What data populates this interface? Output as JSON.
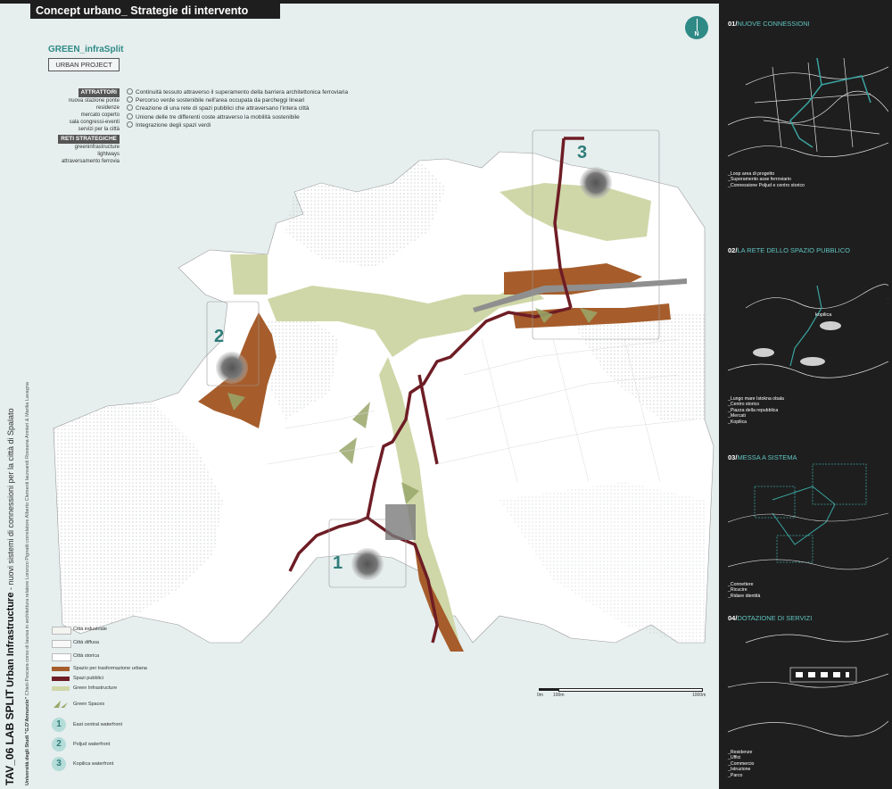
{
  "header": {
    "title": "Concept urbano_ Strategie di intervento"
  },
  "brand": {
    "name": "GREEN_infraSplit",
    "project": "URBAN PROJECT"
  },
  "attrattori": {
    "label": "ATTRATTORI",
    "items": [
      "nuova stazione ponte",
      "residenze",
      "mercato coperto",
      "sala congressi-eventi",
      "servizi per la città"
    ]
  },
  "reti": {
    "label": "RETI STRATEGICHE",
    "items": [
      "greeninfrastructure",
      "lightways",
      "attraversamento ferrovia"
    ]
  },
  "goals": [
    "Continuità tessuto attraverso il superamento della barriera architettonica ferroviaria",
    "Percorso verde sostenibile nell'area occupata da parcheggi lineari",
    "Creazione di una rete di spazi pubblici che attraversano l'intera città",
    "Unione delle tre differenti coste attraverso la mobilità sostenibile",
    "Integrazione degli spazi verdi"
  ],
  "vertical": {
    "tav": "TAV_06 LAB SPLIT",
    "title": "Urban Infrastructure",
    "subtitle": "- nuovi sistemi di connessioni per la città di Spalato",
    "university": "Università degli Studi \"G.D'Annunzio\"",
    "credits": "Chieti-Pescara  corso di laurea in architettura  relatore Lorenzo Pignatti  correlatore Alberto Clementi  laureandi Rossana Armieri & Marilia Lavagna"
  },
  "legend": {
    "items": [
      {
        "label": "Città industriale",
        "color": "#f3f3f0"
      },
      {
        "label": "Città diffusa",
        "color": "#f8f8f8"
      },
      {
        "label": "Città storica",
        "color": "#ffffff"
      },
      {
        "label": "Spazio per trasformazione urbana",
        "color": "#a65d2b"
      },
      {
        "label": "Spazi pubblici",
        "color": "#6e1d25"
      },
      {
        "label": "Green Infrastructure",
        "color": "#cfd7a8"
      },
      {
        "label": "Green Spaces",
        "color": "#9aa86a"
      }
    ],
    "areas": [
      {
        "num": "1",
        "label": "East central waterfront"
      },
      {
        "num": "2",
        "label": "Poljud waterfront"
      },
      {
        "num": "3",
        "label": "Kopilica waterfront"
      }
    ]
  },
  "map_numbers": [
    "1",
    "2",
    "3"
  ],
  "scale": {
    "zero": "0m",
    "mid": "100m",
    "end": "1000m"
  },
  "north": {
    "label": "N"
  },
  "sidebar": {
    "sections": [
      {
        "num": "01/",
        "title": "NUOVE CONNESSIONI",
        "items": [
          "_Loop area di progetto",
          "_Superamento asse ferroviario",
          "_Connessione Poljud e centro storico"
        ]
      },
      {
        "num": "02/",
        "title": "LA RETE DELLO SPAZIO PUBBLICO",
        "items": [
          "_Lungo mare Istokna obala",
          "_Centro storico",
          "_Piazza della repubblica",
          "_Mercati",
          "_Kopilica"
        ]
      },
      {
        "num": "03/",
        "title": "MESSA A SISTEMA",
        "items": [
          "_Connettere",
          "_Ricucire",
          "_Ridare identità"
        ]
      },
      {
        "num": "04/",
        "title": "DOTAZIONE DI SERVIZI",
        "items": [
          "_Residenze",
          "_Uffici",
          "_Commercio",
          "_Istruzione",
          "_Parco"
        ]
      }
    ],
    "map_label_kopilica": "kopilica"
  },
  "colors": {
    "accent": "#2f8a86",
    "public": "#6e1d25",
    "transform": "#a65d2b",
    "green": "#cfd7a8",
    "dark": "#1e1e1e"
  }
}
